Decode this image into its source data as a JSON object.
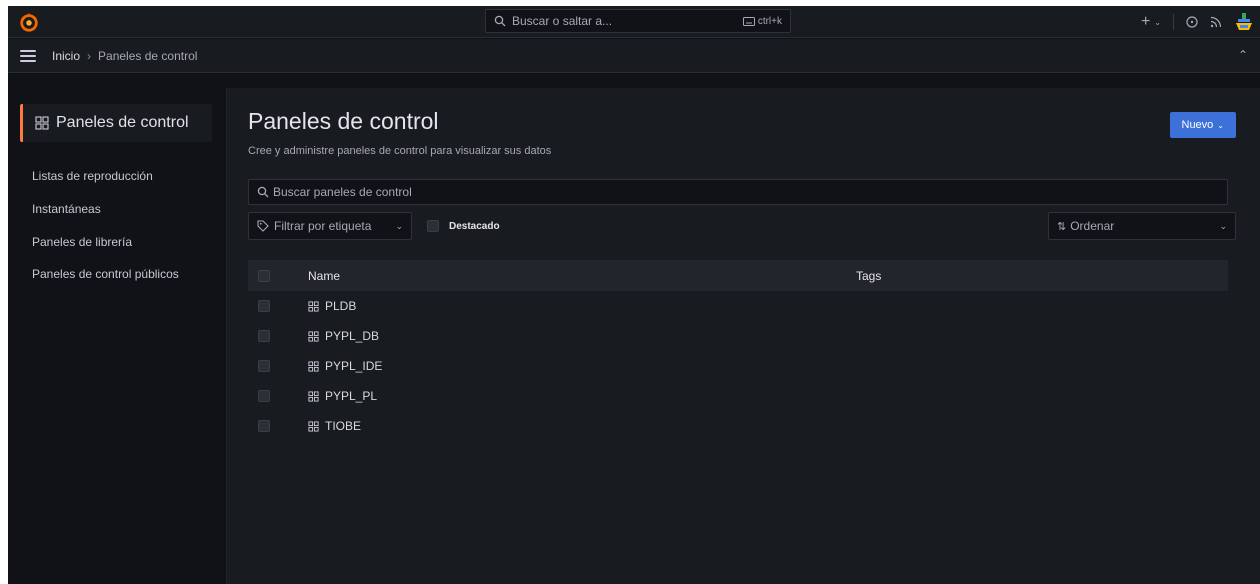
{
  "colors": {
    "accent": "#ff7941",
    "primary": "#3d71d9",
    "bg": "#111217",
    "panel": "#181b1f"
  },
  "topbar": {
    "search_placeholder": "Buscar o saltar a...",
    "shortcut": "ctrl+k",
    "add_label": "+",
    "icons": [
      "grafana-logo-icon",
      "keyboard-icon",
      "plus-icon",
      "help-icon",
      "rss-icon",
      "user-avatar-icon"
    ]
  },
  "breadcrumb": {
    "home": "Inicio",
    "separator": "›",
    "current": "Paneles de control"
  },
  "sidebar": {
    "header": "Paneles de control",
    "items": [
      {
        "label": "Listas de reproducción"
      },
      {
        "label": "Instantáneas"
      },
      {
        "label": "Paneles de librería"
      },
      {
        "label": "Paneles de control públicos"
      }
    ]
  },
  "main": {
    "title": "Paneles de control",
    "subtitle": "Cree y administre paneles de control para visualizar sus datos",
    "new_button": "Nuevo",
    "search_placeholder": "Buscar paneles de control",
    "tag_filter": "Filtrar por etiqueta",
    "starred_label": "Destacado",
    "sort_label": "Ordenar",
    "columns": {
      "name": "Name",
      "tags": "Tags"
    },
    "rows": [
      {
        "name": "PLDB"
      },
      {
        "name": "PYPL_DB"
      },
      {
        "name": "PYPL_IDE"
      },
      {
        "name": "PYPL_PL"
      },
      {
        "name": "TIOBE"
      }
    ]
  }
}
